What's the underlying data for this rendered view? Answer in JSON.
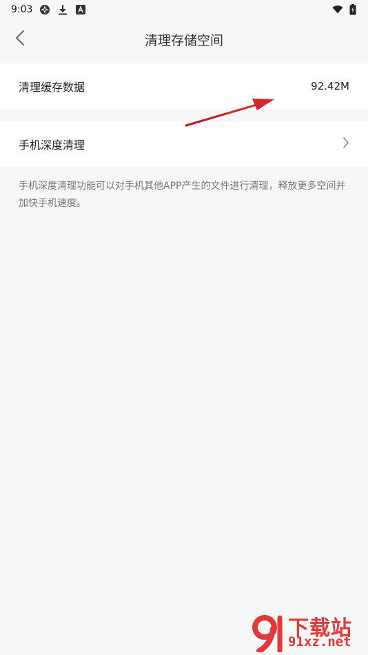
{
  "status_bar": {
    "time": "9:03",
    "icons": [
      "settings-sync-icon",
      "download-icon",
      "app-a-icon",
      "wifi-icon",
      "battery-icon"
    ]
  },
  "header": {
    "title": "清理存储空间",
    "back_icon": "chevron-left-icon"
  },
  "rows": {
    "cache": {
      "label": "清理缓存数据",
      "value": "92.42M"
    },
    "deep_clean": {
      "label": "手机深度清理",
      "chevron_icon": "chevron-right-icon"
    }
  },
  "description": "手机深度清理功能可以对手机其他APP产生的文件进行清理，释放更多空间并加快手机速度。",
  "watermark": {
    "title": "下载站",
    "domain": "91xz.net"
  },
  "colors": {
    "background": "#f7f7f8",
    "card": "#ffffff",
    "annotation_arrow": "#d8262a",
    "watermark": "#e23a3a"
  }
}
